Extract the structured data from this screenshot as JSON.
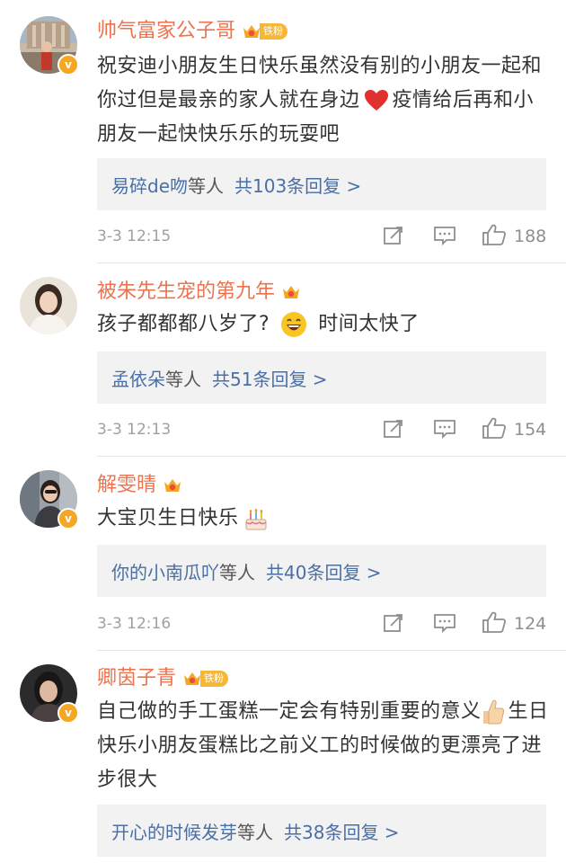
{
  "comments": [
    {
      "username": "帅气富家公子哥",
      "fan_label": "铁粉",
      "verified": "v",
      "text_before": "祝安迪小朋友生日快乐虽然没有别的小朋友一起和你过但是最亲的家人就在身边",
      "emoji": "red-heart",
      "text_after": "疫情给后再和小朋友一起快快乐乐的玩耍吧",
      "reply_names": "易碎de吻",
      "reply_etc": "等人",
      "reply_count": "共103条回复 >",
      "time": "3-3 12:15",
      "likes": "188"
    },
    {
      "username": "被朱先生宠的第九年",
      "text_before": "孩子都都都八岁了?",
      "emoji": "grinning-face",
      "text_after": "时间太快了",
      "reply_names": "孟依朵",
      "reply_etc": "等人",
      "reply_count": "共51条回复 >",
      "time": "3-3 12:13",
      "likes": "154"
    },
    {
      "username": "解雯晴",
      "verified": "v",
      "text_before": "大宝贝生日快乐",
      "emoji": "birthday-cake",
      "reply_names": "你的小南瓜吖",
      "reply_etc": "等人",
      "reply_count": "共40条回复 >",
      "time": "3-3 12:16",
      "likes": "124"
    },
    {
      "username": "卿茵子青",
      "fan_label": "铁粉",
      "verified": "v",
      "text_before": "自己做的手工蛋糕一定会有特别重要的意义",
      "emoji": "thumbs-up",
      "text_after": "生日快乐小朋友蛋糕比之前义工的时候做的更漂亮了进步很大",
      "reply_names": "开心的时候发芽",
      "reply_etc": "等人",
      "reply_count": "共38条回复 >"
    }
  ],
  "colors": {
    "username": "#eb7350",
    "reply_link": "#4a6fa5",
    "badge_gold": "#f5a623",
    "meta_gray": "#a0a0a0",
    "reply_bg": "#f2f2f2"
  },
  "icons": [
    "repost-icon",
    "comment-icon",
    "like-icon",
    "fan-crown-icon",
    "verified-v-icon"
  ]
}
